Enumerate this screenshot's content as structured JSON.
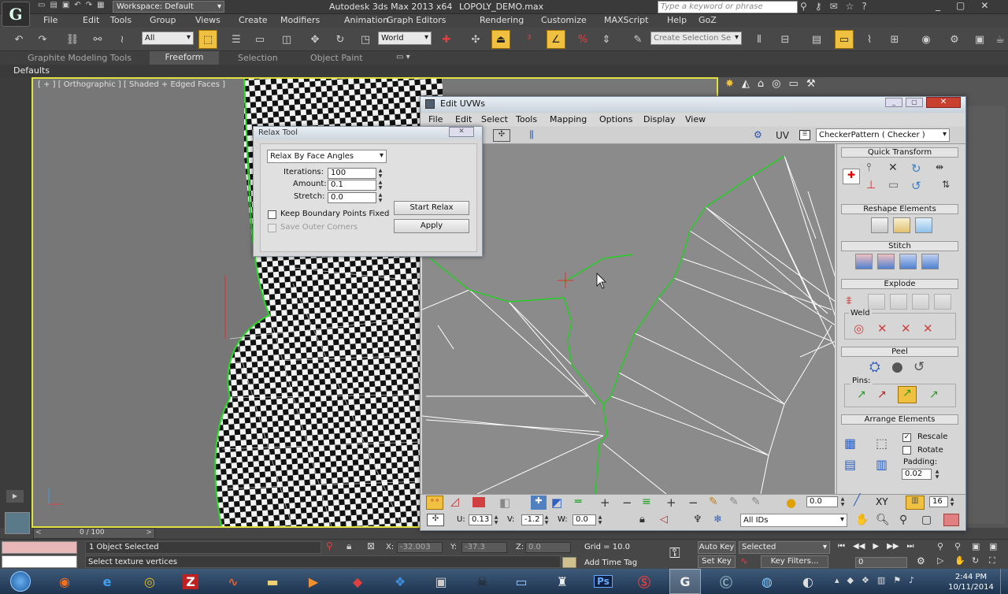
{
  "title_bar": {
    "workspace": "Workspace: Default",
    "app_title": "Autodesk 3ds Max  2013 x64",
    "file_name": "LOPOLY_DEMO.max",
    "search_placeholder": "Type a keyword or phrase"
  },
  "main_menu": [
    "File",
    "Edit",
    "Tools",
    "Group",
    "Views",
    "Create",
    "Modifiers",
    "Animation",
    "Graph Editors",
    "Rendering",
    "Customize",
    "MAXScript",
    "Help",
    "GoZ"
  ],
  "main_toolbar": {
    "selection_filter": "All",
    "reference_coord": "World",
    "named_selection_placeholder": "Create Selection Se"
  },
  "ribbon_tabs": [
    "Graphite Modeling Tools",
    "Freeform",
    "Selection",
    "Object Paint"
  ],
  "defaults_label": "Defaults",
  "viewport": {
    "label": "[ + ] [ Orthographic ] [ Shaded + Edged Faces ]",
    "time_slider": "0 / 100"
  },
  "relax_tool": {
    "title": "Relax Tool",
    "method": "Relax By Face Angles",
    "iterations_label": "Iterations:",
    "iterations": "100",
    "amount_label": "Amount:",
    "amount": "0.1",
    "stretch_label": "Stretch:",
    "stretch": "0.0",
    "start_relax": "Start Relax",
    "apply": "Apply",
    "keep_boundary": "Keep Boundary Points Fixed",
    "save_outer": "Save Outer Corners"
  },
  "edit_uvws": {
    "title": "Edit UVWs",
    "menu": [
      "File",
      "Edit",
      "Select",
      "Tools",
      "Mapping",
      "Options",
      "Display",
      "View"
    ],
    "uv_label": "UV",
    "texture": "CheckerPattern  ( Checker )",
    "u_label": "U:",
    "u_value": "0.13",
    "v_label": "V:",
    "v_value": "-1.2",
    "w_label": "W:",
    "w_value": "0.0",
    "id_filter": "All IDs",
    "angle_value": "0.0",
    "xy_label": "XY",
    "grid_value": "16"
  },
  "uv_panel": {
    "quick_transform": "Quick Transform",
    "reshape_elements": "Reshape Elements",
    "stitch": "Stitch",
    "explode": "Explode",
    "weld": "Weld",
    "peel": "Peel",
    "pins": "Pins:",
    "arrange_elements": "Arrange Elements",
    "rescale": "Rescale",
    "rotate": "Rotate",
    "padding_label": "Padding:",
    "padding": "0.02"
  },
  "status": {
    "objects_selected": "1 Object Selected",
    "prompt": "Select texture vertices",
    "x_label": "X:",
    "x_value": "-32.003",
    "y_label": "Y:",
    "y_value": "-37.3",
    "z_label": "Z:",
    "z_value": "0.0",
    "grid": "Grid = 10.0",
    "add_time_tag": "Add Time Tag",
    "auto_key": "Auto Key",
    "set_key": "Set Key",
    "key_mode": "Selected",
    "key_filters": "Key Filters...",
    "frame": "0"
  },
  "taskbar": {
    "time": "2:44 PM",
    "date": "10/11/2014"
  }
}
